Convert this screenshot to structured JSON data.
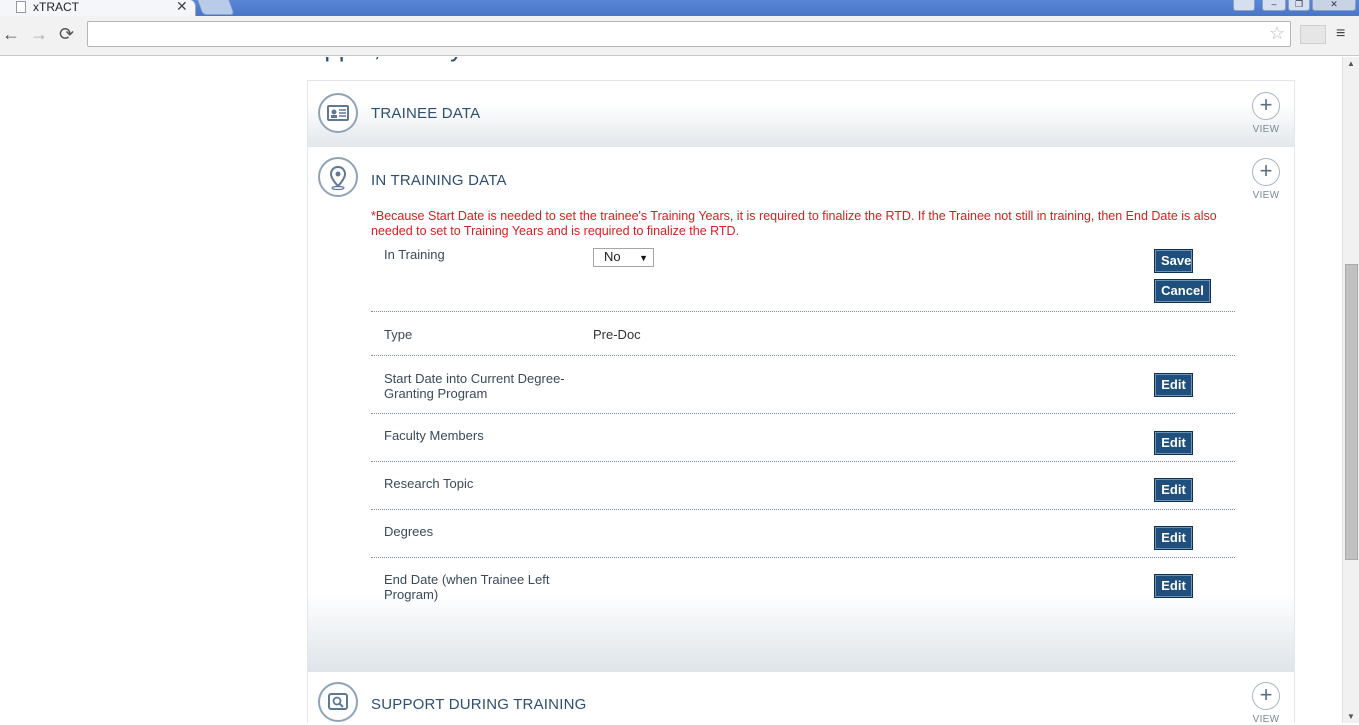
{
  "browser": {
    "tab_title": "xTRACT",
    "tab_close": "✕",
    "url": "",
    "nav_back": "←",
    "nav_forward": "→",
    "nav_reload": "⟳",
    "star": "☆",
    "menu": "≡",
    "win_user": "👤",
    "win_min": "–",
    "win_max": "❐",
    "win_close": "✕"
  },
  "page": {
    "person_name": "Apple, Candy"
  },
  "panels": {
    "trainee": {
      "title": "TRAINEE DATA",
      "view_label": "VIEW",
      "plus": "+",
      "icon": "id-card-icon"
    },
    "in_training": {
      "title": "IN TRAINING DATA",
      "view_label": "VIEW",
      "plus": "+",
      "icon": "map-pin-icon",
      "notice": "*Because Start Date is needed to set the trainee's Training Years, it is required to finalize the RTD. If the Trainee not still in training, then End Date is also needed to set to Training Years and is required to finalize the RTD.",
      "fields": {
        "in_training": {
          "label": "In Training",
          "value": "No",
          "caret": "▼"
        },
        "type": {
          "label": "Type",
          "value": "Pre-Doc"
        },
        "start_date": {
          "label": "Start Date into Current Degree-Granting Program"
        },
        "faculty": {
          "label": "Faculty Members"
        },
        "research": {
          "label": "Research Topic"
        },
        "degrees": {
          "label": "Degrees"
        },
        "end_date": {
          "label": "End Date (when Trainee Left Program)"
        }
      },
      "buttons": {
        "save": "Save",
        "cancel": "Cancel",
        "edit": "Edit"
      }
    },
    "support": {
      "title": "SUPPORT DURING TRAINING",
      "view_label": "VIEW",
      "plus": "+",
      "icon": "magnifier-icon"
    }
  },
  "colors": {
    "accent": "#2d4f71",
    "button": "#1f4f7d",
    "notice": "#d42020"
  }
}
